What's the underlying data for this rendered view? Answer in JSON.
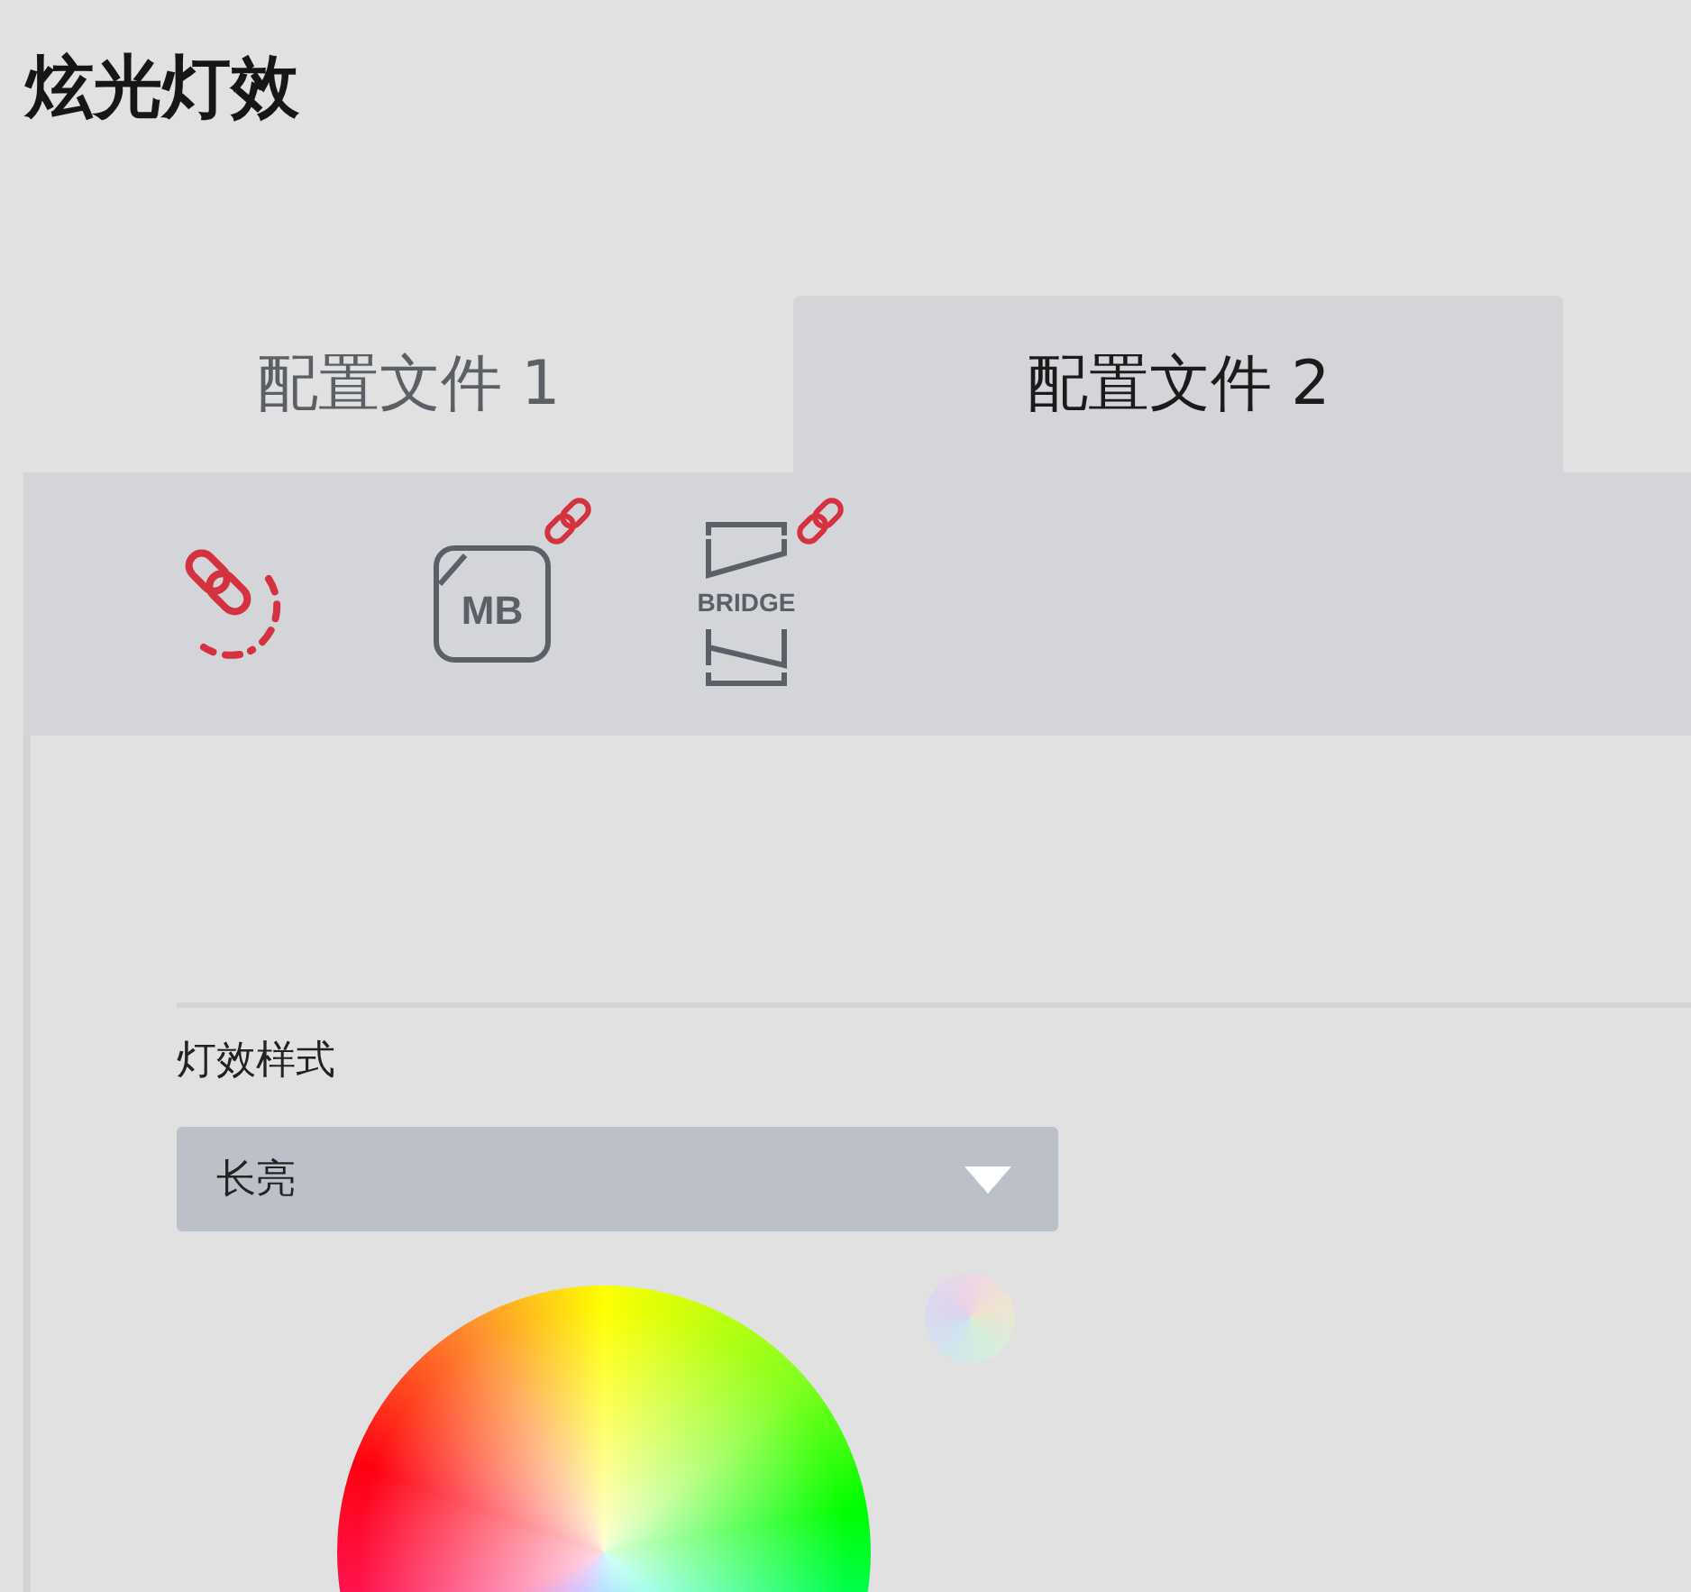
{
  "title": "炫光灯效",
  "tabs": [
    {
      "label": "配置文件 1",
      "selected": false
    },
    {
      "label": "配置文件 2",
      "selected": true
    }
  ],
  "devices": [
    {
      "kind": "sync"
    },
    {
      "kind": "board",
      "label": "MB",
      "linked": true
    },
    {
      "kind": "bridge",
      "label": "BRIDGE",
      "linked": true
    }
  ],
  "effect": {
    "label": "灯效样式",
    "value": "长亮"
  }
}
